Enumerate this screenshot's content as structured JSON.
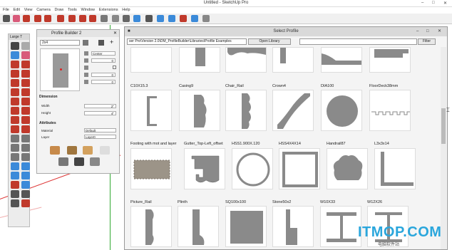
{
  "app": {
    "title": "Untitled - SketchUp Pro"
  },
  "menu": [
    "File",
    "Edit",
    "View",
    "Camera",
    "Draw",
    "Tools",
    "Window",
    "Extensions",
    "Help"
  ],
  "toolset": {
    "title": "Large T"
  },
  "profile_builder": {
    "title": "Profile Builder 2",
    "profile_name": "2x4",
    "align": "Center",
    "side_values": [
      "0",
      "0",
      "0"
    ],
    "dimension_label": "Dimension",
    "width_label": "Width",
    "width_value": "2\"",
    "height_label": "Height",
    "height_value": "4\"",
    "attributes_label": "Attributes",
    "material_label": "Material",
    "material_value": "Default",
    "layer_label": "Layer",
    "layer_value": "Layer0"
  },
  "select_profile": {
    "title": "Select Profile",
    "path": "ser Pro\\Version 2.0\\DM_ProfileBuilder\\Libraries\\Profile Examples",
    "open_library": "Open Library",
    "filter": "Filter",
    "row1": [
      "C10X15.3",
      "Casing9",
      "Chair_Rail",
      "Crown4",
      "DIA100",
      "FloorDeck38mm"
    ],
    "row2": [
      "Footing with mot and layer",
      "Gutter_Top-Left_offset",
      "HSS1.900X.120",
      "HSS4X4X14",
      "Handrail87",
      "L3x3x14"
    ],
    "row3": [
      "Picture_Rail",
      "Plinth",
      "SQ100x100",
      "Stone50x2",
      "W10X33",
      "W12X26"
    ]
  },
  "watermark": {
    "text": "ITMOP.COM",
    "sub": "电脑软件站"
  },
  "colors": {
    "profile_gray": "#8a8a8a",
    "accent_blue": "#2aa6dc"
  }
}
